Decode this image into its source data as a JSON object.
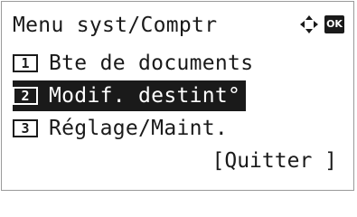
{
  "header": {
    "title": "Menu syst/Comptr",
    "nav_icon": "four-way-arrow-icon",
    "ok_label": "OK"
  },
  "menu": {
    "items": [
      {
        "number": "1",
        "label": "Bte de documents",
        "selected": false
      },
      {
        "number": "2",
        "label": "Modif. destint°",
        "selected": true
      },
      {
        "number": "3",
        "label": "Réglage/Maint.",
        "selected": false
      }
    ]
  },
  "footer": {
    "quit_label": "[Quitter ]"
  },
  "colors": {
    "foreground": "#1a1a1a",
    "background": "#ffffff",
    "border": "#9a9a9a"
  }
}
